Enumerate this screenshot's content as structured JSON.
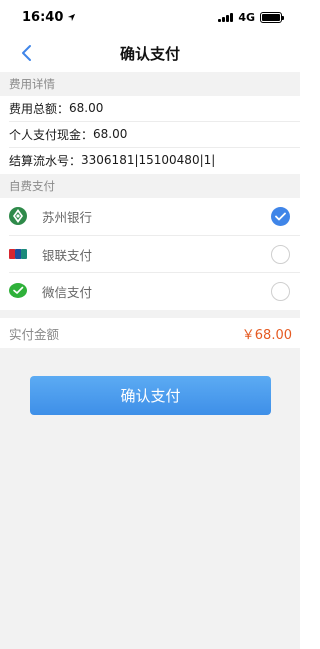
{
  "status_bar": {
    "time": "16:40",
    "network": "4G"
  },
  "nav": {
    "title": "确认支付"
  },
  "fee_section": {
    "title": "费用详情",
    "rows": [
      {
        "label": "费用总额：",
        "value": "68.00"
      },
      {
        "label": "个人支付现金：",
        "value": "68.00"
      },
      {
        "label": "结算流水号：",
        "value": "3306181|15100480|1|"
      }
    ]
  },
  "payment_section": {
    "title": "自费支付",
    "options": [
      {
        "label": "苏州银行",
        "icon": "suzhou-bank-icon",
        "selected": true
      },
      {
        "label": "银联支付",
        "icon": "unionpay-icon",
        "selected": false
      },
      {
        "label": "微信支付",
        "icon": "wechat-pay-icon",
        "selected": false
      }
    ]
  },
  "total": {
    "label": "实付金额",
    "value": "￥68.00"
  },
  "confirm_button": {
    "label": "确认支付"
  },
  "colors": {
    "accent": "#3f85e8",
    "price": "#e55a22",
    "section_bg": "#f2f2f2"
  }
}
